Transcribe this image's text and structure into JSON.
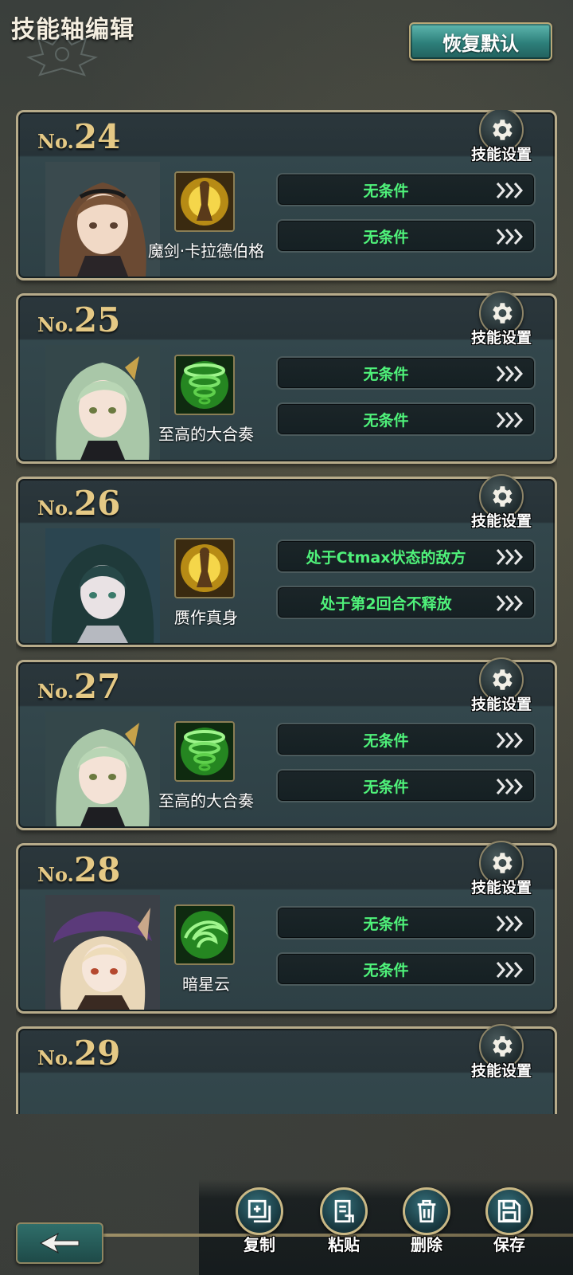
{
  "header": {
    "title": "技能轴编辑",
    "reset_label": "恢复默认"
  },
  "colors": {
    "accent_gold": "#e5c985",
    "condition_green": "#4ff27a",
    "button_teal": "#2d7f7a"
  },
  "cards": [
    {
      "no_prefix": "No.",
      "no": "24",
      "settings_label": "技能设置",
      "character": "brown-haired-swordswoman",
      "skill_icon": "golden-warrior-skill-icon",
      "skill_name": "魔剑·卡拉德伯格",
      "conditions": [
        "无条件",
        "无条件"
      ]
    },
    {
      "no_prefix": "No.",
      "no": "25",
      "settings_label": "技能设置",
      "character": "green-haired-girl",
      "skill_icon": "green-tornado-skill-icon",
      "skill_name": "至高的大合奏",
      "conditions": [
        "无条件",
        "无条件"
      ]
    },
    {
      "no_prefix": "No.",
      "no": "26",
      "settings_label": "技能设置",
      "character": "dark-green-haired-girl",
      "skill_icon": "golden-warrior-skill-icon",
      "skill_name": "赝作真身",
      "conditions": [
        "处于Ctmax状态的敌方",
        "处于第2回合不释放"
      ]
    },
    {
      "no_prefix": "No.",
      "no": "27",
      "settings_label": "技能设置",
      "character": "green-haired-girl",
      "skill_icon": "green-tornado-skill-icon",
      "skill_name": "至高的大合奏",
      "conditions": [
        "无条件",
        "无条件"
      ]
    },
    {
      "no_prefix": "No.",
      "no": "28",
      "settings_label": "技能设置",
      "character": "blonde-girl-purple-hat",
      "skill_icon": "green-tornado-skill-icon",
      "skill_name": "暗星云",
      "conditions": [
        "无条件",
        "无条件"
      ]
    },
    {
      "no_prefix": "No.",
      "no": "29",
      "settings_label": "技能设置",
      "character": "",
      "skill_icon": "",
      "skill_name": "",
      "conditions": []
    }
  ],
  "toolbar": {
    "copy_label": "复制",
    "paste_label": "粘贴",
    "delete_label": "删除",
    "save_label": "保存"
  }
}
